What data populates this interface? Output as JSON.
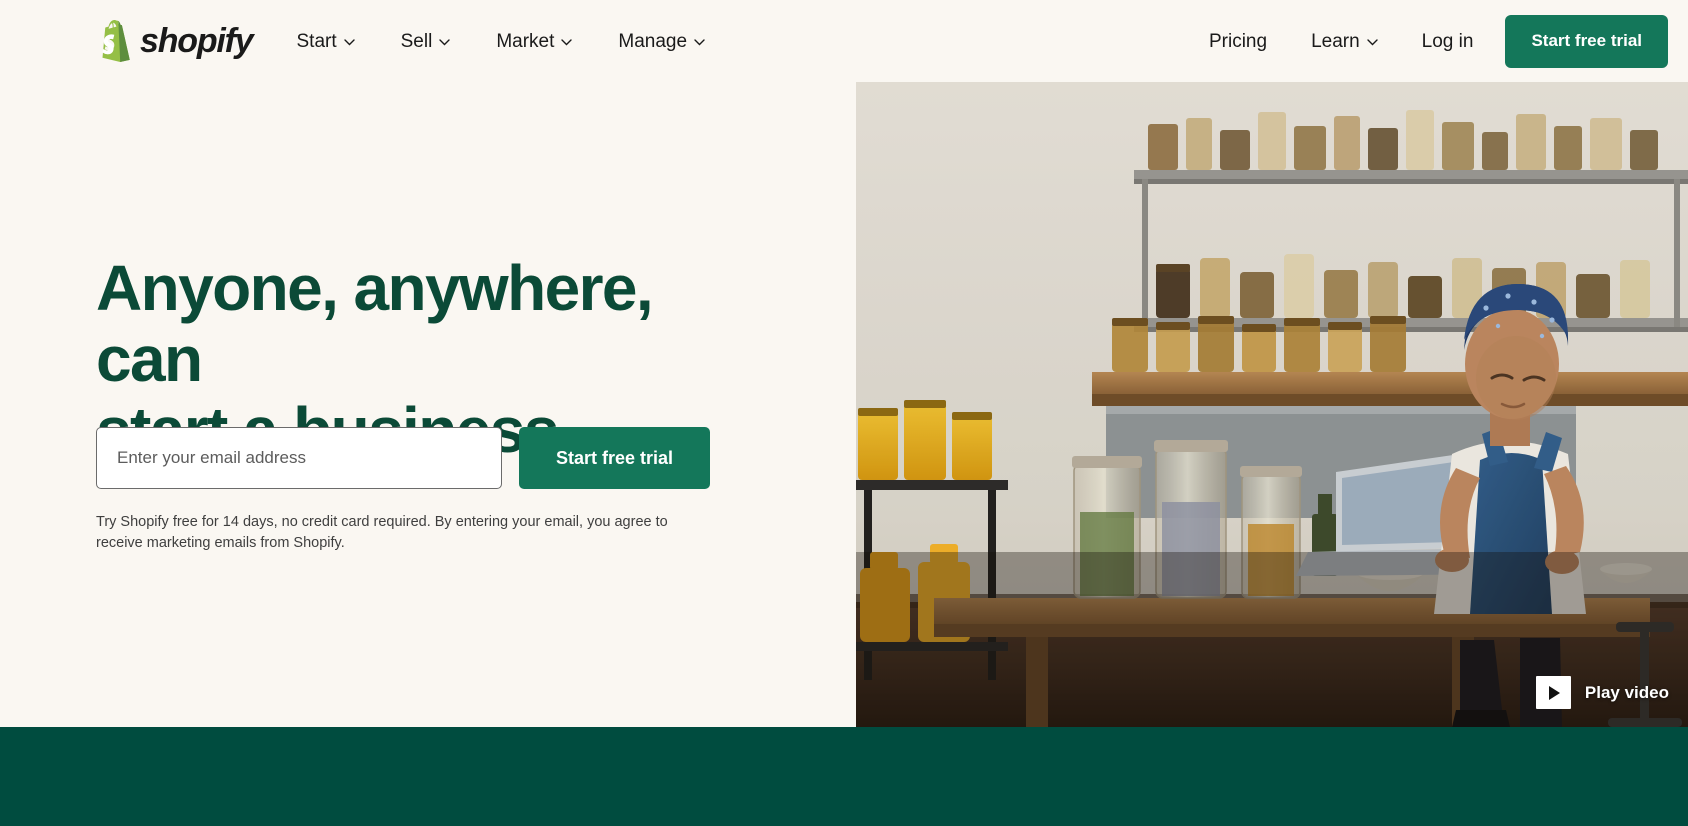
{
  "brand": {
    "name": "shopify",
    "logo_icon": "shopify-bag-icon",
    "green": "#14775a",
    "dark_green": "#004c3f",
    "headline_green": "#0b4a37",
    "background": "#faf7f2"
  },
  "header": {
    "nav": [
      {
        "label": "Start",
        "has_dropdown": true,
        "icon": "chevron-down-icon"
      },
      {
        "label": "Sell",
        "has_dropdown": true,
        "icon": "chevron-down-icon"
      },
      {
        "label": "Market",
        "has_dropdown": true,
        "icon": "chevron-down-icon"
      },
      {
        "label": "Manage",
        "has_dropdown": true,
        "icon": "chevron-down-icon"
      }
    ],
    "right": [
      {
        "label": "Pricing",
        "has_dropdown": false
      },
      {
        "label": "Learn",
        "has_dropdown": true,
        "icon": "chevron-down-icon"
      },
      {
        "label": "Log in",
        "has_dropdown": false
      }
    ],
    "cta_label": "Start free trial"
  },
  "hero": {
    "headline_line1": "Anyone, anywhere, can",
    "headline_line2": "start a business",
    "email_placeholder": "Enter your email address",
    "email_value": "",
    "cta_label": "Start free trial",
    "legal": "Try Shopify free for 14 days, no credit card required. By entering your email, you agree to receive marketing emails from Shopify."
  },
  "media": {
    "play_label": "Play video",
    "play_icon": "play-triangle-icon",
    "alt": "Woman working on a laptop at a wooden table in a shop filled with jars of goods"
  }
}
